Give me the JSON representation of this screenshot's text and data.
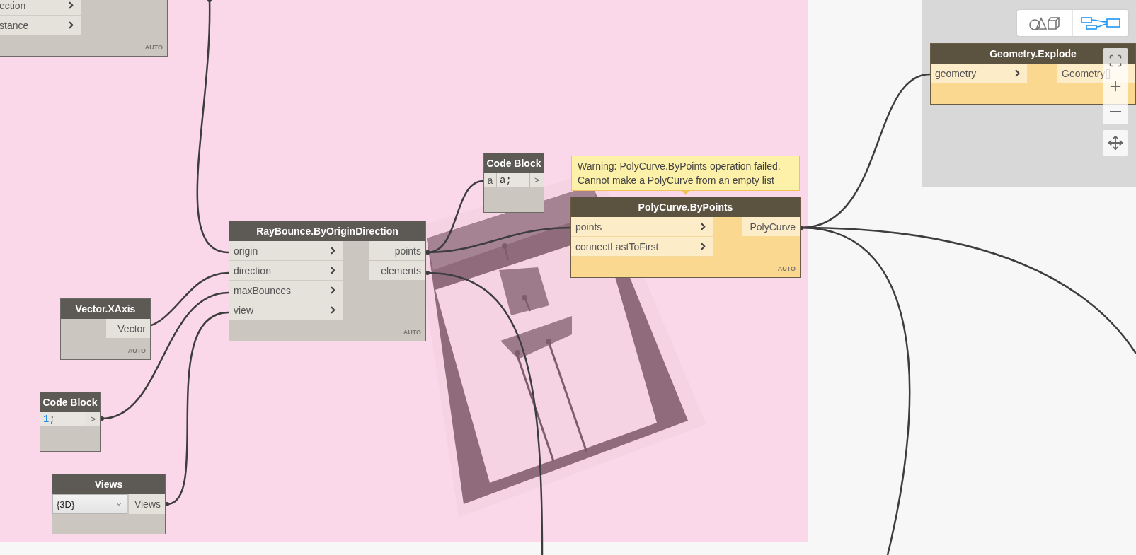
{
  "groups": [
    {
      "color": "#fad8e9"
    },
    {
      "color": "#d8d8d8"
    }
  ],
  "nodes": [
    {
      "kind": "standard",
      "has_warning": false,
      "inputs": [
        "ection",
        "stance"
      ],
      "lacing": "AUTO"
    },
    {
      "kind": "code_block",
      "has_warning": false,
      "title": "Code Block",
      "input": "a",
      "code": [
        {
          "text": "a;",
          "kind": "plain"
        }
      ],
      "output": ">"
    },
    {
      "kind": "standard",
      "has_warning": true,
      "title": "PolyCurve.ByPoints",
      "warning_message": "Warning: PolyCurve.ByPoints operation failed.\nCannot make a PolyCurve from an empty list",
      "inputs": [
        "points",
        "connectLastToFirst"
      ],
      "outputs": [
        "PolyCurve"
      ],
      "lacing": "AUTO"
    },
    {
      "kind": "standard",
      "has_warning": false,
      "title": "RayBounce.ByOriginDirection",
      "inputs": [
        "origin",
        "direction",
        "maxBounces",
        "view"
      ],
      "outputs": [
        "points",
        "elements"
      ],
      "lacing": "AUTO"
    },
    {
      "kind": "standard",
      "has_warning": false,
      "title": "Vector.XAxis",
      "outputs": [
        "Vector"
      ],
      "lacing": "AUTO"
    },
    {
      "kind": "code_block",
      "has_warning": false,
      "title": "Code Block",
      "code": [
        {
          "text": "1",
          "kind": "number"
        },
        {
          "text": ";",
          "kind": "plain"
        }
      ],
      "output": ">"
    },
    {
      "kind": "dropdown",
      "has_warning": false,
      "title": "Views",
      "value": "{3D}",
      "output": "Views"
    },
    {
      "kind": "standard",
      "has_warning": true,
      "title": "Geometry.Explode",
      "inputs": [
        "geometry"
      ],
      "outputs": [
        "Geometry[]"
      ]
    }
  ],
  "view_toggle": [
    {
      "selected": false
    },
    {
      "selected": true
    }
  ]
}
